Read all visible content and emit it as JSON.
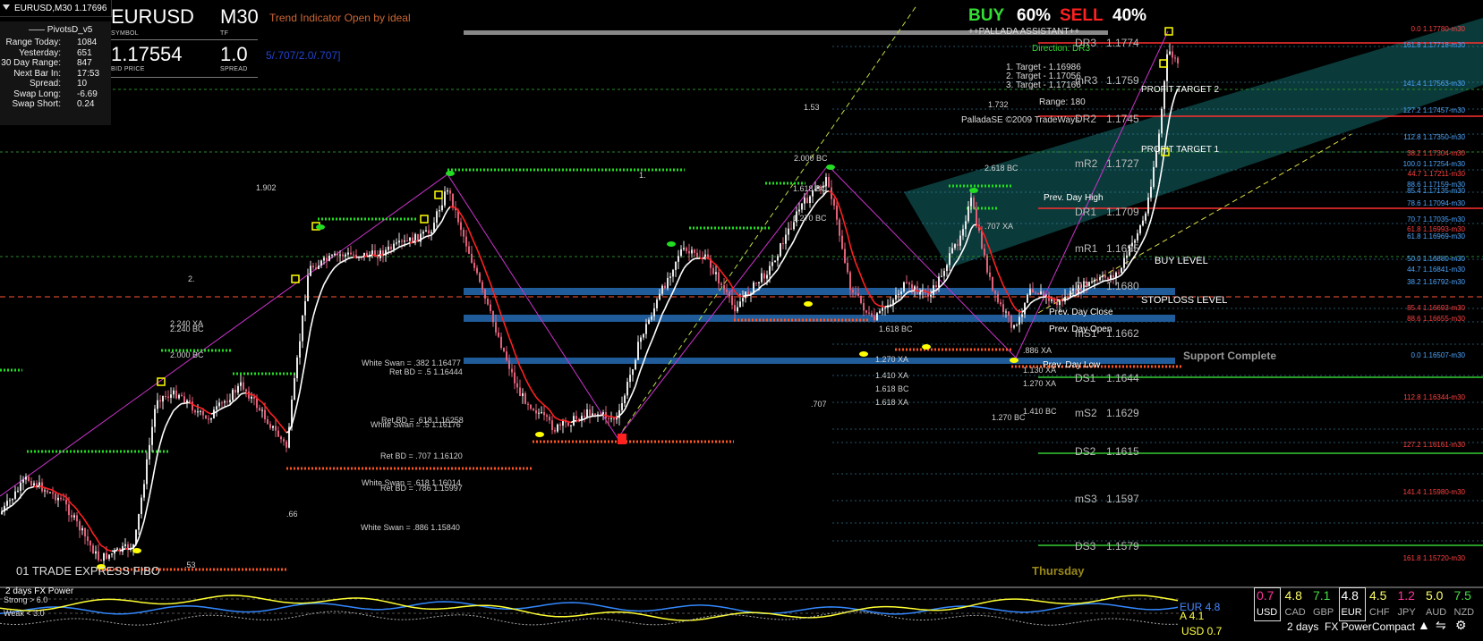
{
  "window": {
    "title": "EURUSD,M30  1.17696"
  },
  "pivots_panel": {
    "title": "PivotsD_v5",
    "rows": [
      {
        "label": "Range  Today:",
        "value": "1084"
      },
      {
        "label": "Yesterday:",
        "value": "651"
      },
      {
        "label": "30 Day Range:",
        "value": "847"
      },
      {
        "label": "Next Bar In:",
        "value": "17:53"
      },
      {
        "label": "Spread:",
        "value": "10"
      },
      {
        "label": "Swap  Long:",
        "value": "-6.69"
      },
      {
        "label": "Swap  Short:",
        "value": "0.24"
      }
    ]
  },
  "symbol_panel": {
    "symbol": "EURUSD",
    "symbol_caption": "SYMBOL",
    "timeframe": "M30",
    "tf_caption": "TF",
    "bid": "1.17554",
    "bid_caption": "BID PRICE",
    "spread": "1.0",
    "spread_caption": "SPREAD"
  },
  "trend_indicator": "Trend Indicator Open by ideal",
  "ratio_text": "5/.707/2.0/.707]",
  "buy_sell": {
    "buy_label": "BUY",
    "buy_pct": "60%",
    "sell_label": "SELL",
    "sell_pct": "40%"
  },
  "palladA": {
    "assistant": "++PALLADA ASSISTANT++",
    "direction": "Direction: DR3",
    "targets": [
      "1. Target - 1.16986",
      "2. Target - 1.17056",
      "3. Target - 1.17166"
    ],
    "range": "Range: 180",
    "copyright": "PalladaSE ©2009 TradeWays"
  },
  "pivot_levels": [
    {
      "name": "DR3",
      "price": "1.1774"
    },
    {
      "name": "mR3",
      "price": "1.1759"
    },
    {
      "name": "DR2",
      "price": "1.1745"
    },
    {
      "name": "mR2",
      "price": "1.1727"
    },
    {
      "name": "DR1",
      "price": "1.1709"
    },
    {
      "name": "mR1",
      "price": "1.1695"
    },
    {
      "name": "DP",
      "price": "1.1680"
    },
    {
      "name": "mS1",
      "price": "1.1662"
    },
    {
      "name": "DS1",
      "price": "1.1644"
    },
    {
      "name": "mS2",
      "price": "1.1629"
    },
    {
      "name": "DS2",
      "price": "1.1615"
    },
    {
      "name": "mS3",
      "price": "1.1597"
    },
    {
      "name": "DS3",
      "price": "1.1579"
    }
  ],
  "right_labels": {
    "profit_target_2": "PROFIT TARGET 2",
    "profit_target_1": "PROFIT TARGET 1",
    "buy_level": "BUY LEVEL",
    "stoploss_level": "STOPLOSS LEVEL",
    "support_complete": "Support Complete",
    "prev_day_high": "Prev. Day High",
    "prev_day_close": "Prev. Day Close",
    "prev_day_open": "Prev. Day Open",
    "prev_day_low": "Prev. Day Low",
    "day": "Thursday"
  },
  "fib_levels": [
    {
      "label": "0.0  1.17780-m30",
      "color": "#ff4040"
    },
    {
      "label": "161.8  1.17718-m30",
      "color": "#4da6ff"
    },
    {
      "label": "141.4  1.17563-m30",
      "color": "#4da6ff"
    },
    {
      "label": "127.2  1.17457-m30",
      "color": "#4da6ff"
    },
    {
      "label": "112.8  1.17350-m30",
      "color": "#4da6ff"
    },
    {
      "label": "38.2  1.17304-m30",
      "color": "#ff4040"
    },
    {
      "label": "100.0  1.17254-m30",
      "color": "#4da6ff"
    },
    {
      "label": "44.7  1.17211-m30",
      "color": "#ff4040"
    },
    {
      "label": "88.6  1.17159-m30",
      "color": "#4da6ff"
    },
    {
      "label": "85.4  1.17135-m30",
      "color": "#4da6ff"
    },
    {
      "label": "78.6  1.17094-m30",
      "color": "#4da6ff"
    },
    {
      "label": "70.7  1.17035-m30",
      "color": "#4da6ff"
    },
    {
      "label": "61.8  1.16993-m30",
      "color": "#ff4040"
    },
    {
      "label": "61.8  1.16969-m30",
      "color": "#4da6ff"
    },
    {
      "label": "50.0  1.16880-m30",
      "color": "#4da6ff"
    },
    {
      "label": "44.7  1.16841-m30",
      "color": "#4da6ff"
    },
    {
      "label": "38.2  1.16792-m30",
      "color": "#4da6ff"
    },
    {
      "label": "85.4  1.16693-m30",
      "color": "#ff4040"
    },
    {
      "label": "88.6  1.16655-m30",
      "color": "#ff4040"
    },
    {
      "label": "0.0  1.16507-m30",
      "color": "#4da6ff"
    },
    {
      "label": "112.8  1.16344-m30",
      "color": "#ff4040"
    },
    {
      "label": "127.2  1.16161-m30",
      "color": "#ff4040"
    },
    {
      "label": "141.4  1.15980-m30",
      "color": "#ff4040"
    },
    {
      "label": "161.8  1.15720-m30",
      "color": "#ff4040"
    }
  ],
  "chart_annotations": [
    "White Swan = .382  1.16477",
    "Ret BD = .5  1.16444",
    "Ret BD = .618  1.16258",
    "White Swan = .5  1.16176",
    "Ret BD = .707  1.16120",
    "White Swan = .618  1.16014",
    "Ret BD = .786  1.15997",
    "White Swan = .886  1.15840",
    "1.902",
    "2.",
    "1.53",
    "1.732",
    "1.",
    ".707",
    ".66",
    ".53",
    "2.000 BC",
    "1.618 BC",
    "1.270 BC",
    "1.618 BC",
    "1.270 XA",
    "1.410 XA",
    "1.618 BC",
    "1.618 XA",
    "2.618 BC",
    ".707 XA",
    "1.130 XA",
    "1.270 XA",
    "1.410 BC",
    "1.270 BC",
    ".886 XA",
    "2.240 XA",
    "2.240 BC",
    "2.000 BC"
  ],
  "trade_label": "01 TRADE EXPRESS FIBO",
  "bottom": {
    "title": "2 days FX Power",
    "strong": "Strong > 6.0",
    "weak": "Weak < 3.0",
    "eur_tag": "EUR 4.8",
    "a_tag": "A 4.1",
    "usd_tag": "USD 0.7",
    "currencies": [
      {
        "name": "USD",
        "value": "0.7",
        "color": "#ff3399",
        "boxed": true
      },
      {
        "name": "CAD",
        "value": "4.8",
        "color": "#ffff66",
        "boxed": false
      },
      {
        "name": "GBP",
        "value": "7.1",
        "color": "#44dd44",
        "boxed": false
      },
      {
        "name": "EUR",
        "value": "4.8",
        "color": "#ffffff",
        "boxed": true
      },
      {
        "name": "CHF",
        "value": "4.5",
        "color": "#ffff66",
        "boxed": false
      },
      {
        "name": "JPY",
        "value": "1.2",
        "color": "#ff3399",
        "boxed": false
      },
      {
        "name": "AUD",
        "value": "5.0",
        "color": "#ffff66",
        "boxed": false
      },
      {
        "name": "NZD",
        "value": "7.5",
        "color": "#44dd44",
        "boxed": false
      }
    ],
    "mode_2days": "2 days",
    "mode_power": "FX Power",
    "mode_compact": "Compact"
  },
  "colors": {
    "bull": "#e8e8e8",
    "bear": "#e0607a",
    "green": "#33cc33",
    "red": "#ff3030",
    "orange": "#ff5522",
    "blue": "#1f5c99",
    "yellow": "#ffff00",
    "magenta": "#cc33cc",
    "teal": "#0d4444"
  }
}
